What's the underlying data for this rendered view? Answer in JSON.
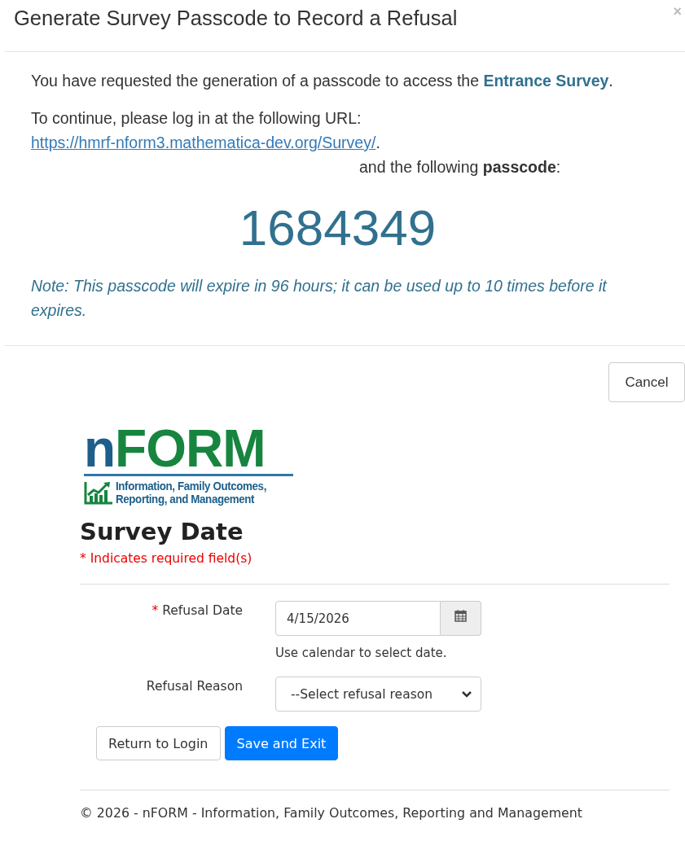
{
  "dialog": {
    "title": "Generate Survey Passcode to Record a Refusal",
    "close": "×",
    "intro": "You have requested the generation of a passcode to access the **Entrance Survey**.",
    "continue_text": "To continue, please log in at the following URL:",
    "url": "https://hmrf-nform3.mathematica-dev.org/Survey/",
    "url_suffix": ".",
    "passcode_intro": "and the following **passcode**:",
    "passcode": "1684349",
    "note": "Note: This passcode will expire in 96 hours; it can be used up to 10 times before it expires.",
    "cancel": "Cancel"
  },
  "logo": {
    "lead": "n",
    "rest": "FORM",
    "tagline_1": "Information, Family Outcomes,",
    "tagline_2": "Reporting, and Management"
  },
  "page": {
    "heading": "Survey Date",
    "required_note": "* Indicates required field(s)"
  },
  "fields": [
    {
      "kind": "date",
      "label": "Refusal Date",
      "required_mark": "*",
      "value": "4/15/2026",
      "help": "Use calendar to select date."
    },
    {
      "kind": "select",
      "label": "Refusal Reason",
      "placeholder": "--Select refusal reason"
    }
  ],
  "buttons": [
    {
      "label": "Return to Login",
      "primary": false
    },
    {
      "label": "Save and Exit",
      "primary": true
    }
  ],
  "footer": "© 2026 - nFORM - Information, Family Outcomes, Reporting and Management"
}
